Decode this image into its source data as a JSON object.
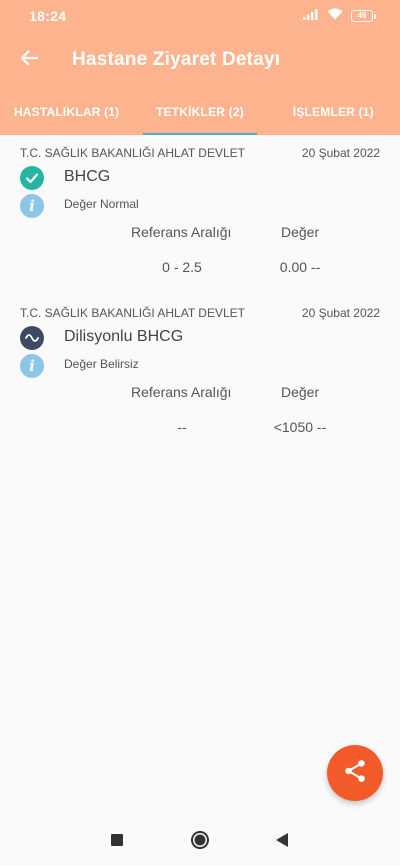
{
  "status_bar": {
    "time": "18:24",
    "battery_level": "46",
    "icons": [
      "signal-icon",
      "wifi-icon",
      "battery-icon"
    ]
  },
  "app_bar": {
    "back_icon": "back-arrow-icon",
    "title": "Hastane Ziyaret Detayı"
  },
  "tabs": [
    {
      "label": "HASTALIKLAR (1)",
      "active": false
    },
    {
      "label": "TETKİKLER (2)",
      "active": true
    },
    {
      "label": "İŞLEMLER (1)",
      "active": false
    }
  ],
  "records": [
    {
      "hospital": "T.C. SAĞLIK BAKANLIĞI AHLAT DEVLET",
      "date": "20 Şubat 2022",
      "status_icon": "check-circle-icon",
      "status_color": "#26b5a0",
      "test_name": "BHCG",
      "info_icon": "info-icon",
      "note": "Değer Normal",
      "ref_header": "Referans Aralığı",
      "value_header": "Değer",
      "ref_range": "0 - 2.5",
      "value": "0.00 --"
    },
    {
      "hospital": "T.C. SAĞLIK BAKANLIĞI AHLAT DEVLET",
      "date": "20 Şubat 2022",
      "status_icon": "wave-circle-icon",
      "status_color": "#3c4a64",
      "test_name": "Dilisyonlu BHCG",
      "info_icon": "info-icon",
      "note": "Değer Belirsiz",
      "ref_header": "Referans Aralığı",
      "value_header": "Değer",
      "ref_range": "--",
      "value": "<1050 --"
    }
  ],
  "fab": {
    "icon": "share-icon",
    "color": "#f25a2a"
  },
  "nav_bar": {
    "buttons": [
      "recents-square-icon",
      "home-circle-icon",
      "back-triangle-icon"
    ]
  },
  "colors": {
    "header_bg": "#fdb38d",
    "tab_indicator": "#4ea7cc",
    "info_icon_bg": "#8ec5ea"
  }
}
